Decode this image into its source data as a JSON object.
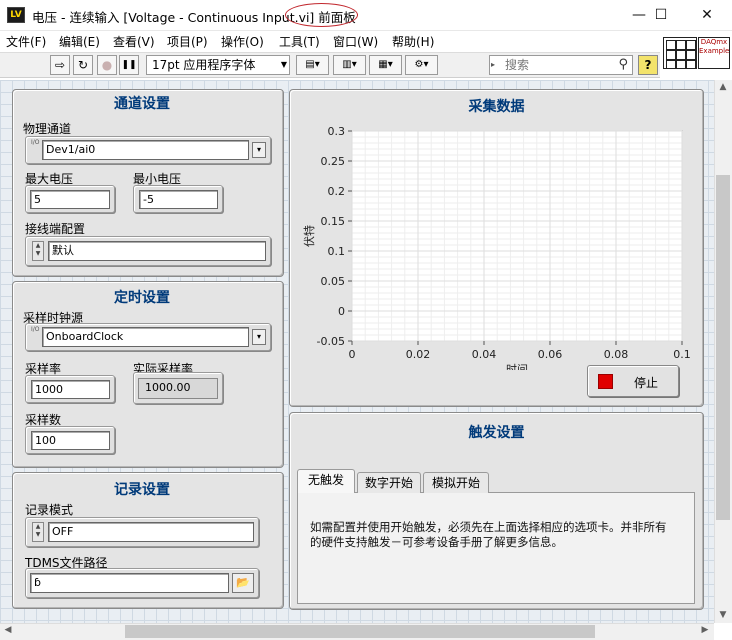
{
  "window": {
    "title": "电压 - 连续输入 [Voltage - Continuous Input.vi] 前面板",
    "app_icon_text": "LV",
    "minimize_glyph": "—",
    "maximize_glyph": "☐",
    "close_glyph": "✕"
  },
  "menu": [
    "文件(F)",
    "编辑(E)",
    "查看(V)",
    "项目(P)",
    "操作(O)",
    "工具(T)",
    "窗口(W)",
    "帮助(H)"
  ],
  "toolbar": {
    "run_glyph": "⇨",
    "run_continuous_glyph": "↻",
    "abort_glyph": "●",
    "pause_glyph": "❚❚",
    "font_label": "17pt 应用程序字体",
    "font_arrow": "▼",
    "align_glyph": "▤▾",
    "distribute_glyph": "▥▾",
    "resize_glyph": "▦▾",
    "reorder_glyph": "⚙▾",
    "search_placeholder": "搜索",
    "search_glyph": "⚲",
    "help_glyph": "?",
    "daqmx_icon_text": "DAQmx Example"
  },
  "channel_settings": {
    "title": "通道设置",
    "physical_channel_label": "物理通道",
    "physical_channel_value": "Dev1/ai0",
    "io_glyph": "I/O",
    "max_voltage_label": "最大电压",
    "max_voltage_value": "5",
    "min_voltage_label": "最小电压",
    "min_voltage_value": "-5",
    "terminal_config_label": "接线端配置",
    "terminal_config_value": "默认"
  },
  "timing_settings": {
    "title": "定时设置",
    "clock_source_label": "采样时钟源",
    "clock_source_value": "OnboardClock",
    "rate_label": "采样率",
    "rate_value": "1000",
    "actual_rate_label": "实际采样率",
    "actual_rate_value": "1000.00",
    "samples_label": "采样数",
    "samples_value": "100"
  },
  "logging_settings": {
    "title": "记录设置",
    "mode_label": "记录模式",
    "mode_value": "OFF",
    "tdms_path_label": "TDMS文件路径",
    "tdms_path_value": "",
    "path_glyph": "ɓ",
    "browse_glyph": "📂"
  },
  "acquisition": {
    "title": "采集数据",
    "stop_label": "停止"
  },
  "chart_data": {
    "type": "line",
    "title": "采集数据",
    "xlabel": "时间",
    "ylabel": "伏特",
    "xlim": [
      0,
      0.1
    ],
    "ylim": [
      -0.05,
      0.3
    ],
    "x_ticks": [
      "0",
      "0.02",
      "0.04",
      "0.06",
      "0.08",
      "0.1"
    ],
    "y_ticks": [
      "0.3",
      "0.25",
      "0.2",
      "0.15",
      "0.1",
      "0.05",
      "0",
      "-0.05"
    ],
    "grid": true,
    "series": []
  },
  "trigger": {
    "title": "触发设置",
    "tabs": [
      "无触发",
      "数字开始",
      "模拟开始"
    ],
    "active_tab": 0,
    "message": "如需配置并使用开始触发，必须先在上面选择相应的选项卡。并非所有的硬件支持触发－可参考设备手册了解更多信息。"
  },
  "colors": {
    "panel_title": "#003a7a",
    "stop_indicator": "#e00000",
    "canvas_grid": "#cfd9e3"
  }
}
